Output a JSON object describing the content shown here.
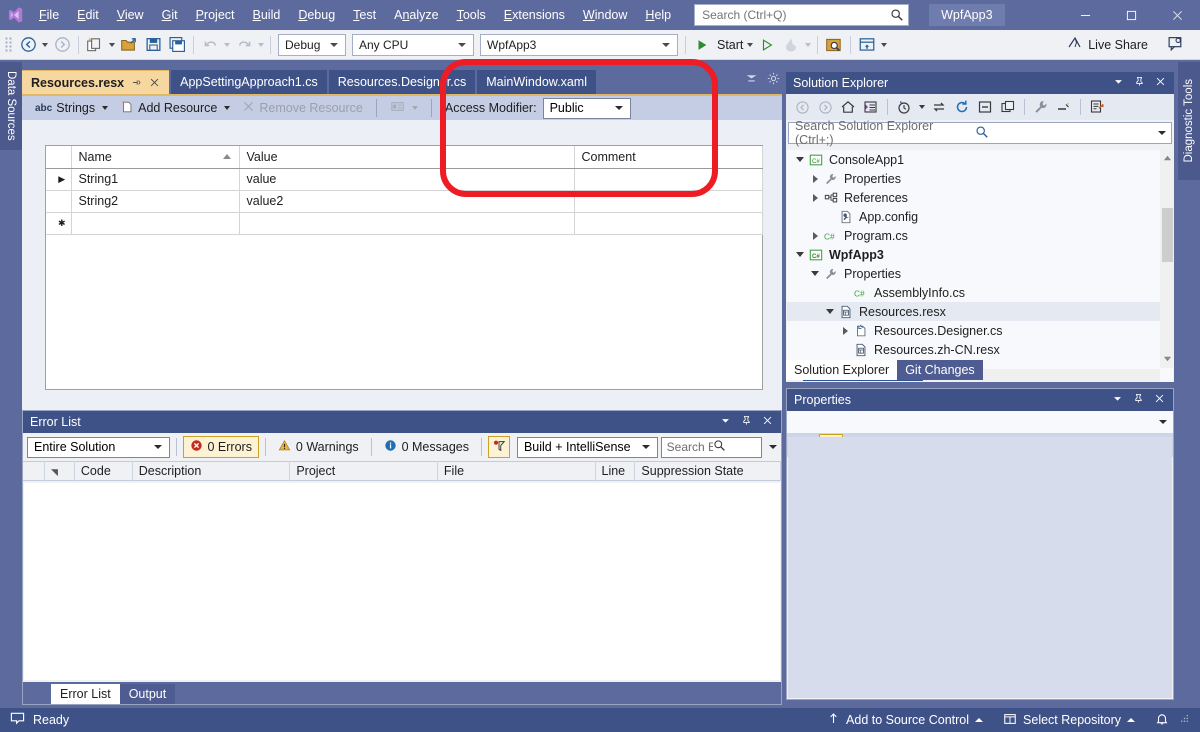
{
  "titlebar": {
    "logo_icon": "visual-studio-logo",
    "menus": [
      "File",
      "Edit",
      "View",
      "Git",
      "Project",
      "Build",
      "Debug",
      "Test",
      "Analyze",
      "Tools",
      "Extensions",
      "Window",
      "Help"
    ],
    "search_placeholder": "Search (Ctrl+Q)",
    "search_icon": "search-icon",
    "project_name": "WpfApp3",
    "minimize_icon": "minimize-icon",
    "maximize_icon": "maximize-icon",
    "close_icon": "close-icon"
  },
  "toolbar": {
    "nav_back_icon": "navigate-back-icon",
    "nav_forward_icon": "navigate-forward-icon",
    "new_project_icon": "new-project-icon",
    "open_file_icon": "open-file-icon",
    "save_icon": "save-icon",
    "save_all_icon": "save-all-icon",
    "undo_icon": "undo-icon",
    "redo_icon": "redo-icon",
    "configuration": "Debug",
    "platform": "Any CPU",
    "startup_project": "WpfApp3",
    "start_label": "Start",
    "start_icon": "play-icon",
    "attach_icon": "attach-play-icon",
    "hotreload_icon": "hot-reload-icon",
    "solution_explorer_search_icon": "find-in-files-icon",
    "layout_icon": "window-layout-icon",
    "live_share_label": "Live Share",
    "live_share_icon": "live-share-icon",
    "feedback_icon": "send-feedback-icon"
  },
  "side_tabs": {
    "left": "Data Sources",
    "right": "Diagnostic Tools"
  },
  "editor": {
    "tabs": [
      {
        "label": "Resources.resx",
        "active": true,
        "pin_icon": "pin-icon",
        "close_icon": "close-icon"
      },
      {
        "label": "AppSettingApproach1.cs",
        "active": false
      },
      {
        "label": "Resources.Designer.cs",
        "active": false
      },
      {
        "label": "MainWindow.xaml",
        "active": false
      }
    ],
    "tab_overflow_icon": "tab-overflow-icon",
    "tab_settings_icon": "gear-icon",
    "toolbar": {
      "strings_icon": "abc-icon",
      "strings_label": "Strings",
      "add_resource_icon": "add-resource-icon",
      "add_resource_label": "Add Resource",
      "remove_resource_icon": "remove-resource-icon",
      "remove_resource_label": "Remove Resource",
      "view_icon": "view-mode-icon",
      "access_modifier_label": "Access Modifier:",
      "access_modifier_value": "Public"
    },
    "grid": {
      "columns": [
        "",
        "Name",
        "Value",
        "Comment"
      ],
      "sorted_column": "Name",
      "sort_direction": "ascending",
      "rows": [
        {
          "marker": "▶",
          "name": "String1",
          "value": "value",
          "comment": ""
        },
        {
          "marker": "",
          "name": "String2",
          "value": "value2",
          "comment": ""
        },
        {
          "marker": "✱",
          "name": "",
          "value": "",
          "comment": ""
        }
      ]
    }
  },
  "error_list": {
    "title": "Error List",
    "dropdown_icon": "panel-menu-icon",
    "pin_icon": "pin-icon",
    "close_icon": "close-icon",
    "scope": "Entire Solution",
    "errors_label": "0 Errors",
    "errors_icon": "error-icon",
    "warnings_label": "0 Warnings",
    "warnings_icon": "warning-icon",
    "messages_label": "0 Messages",
    "messages_icon": "info-icon",
    "filter_icon": "error-filter-icon",
    "build_filter": "Build + IntelliSense",
    "search_placeholder": "Search Error L",
    "search_icon": "search-icon",
    "columns": [
      "",
      "",
      "Code",
      "Description",
      "Project",
      "File",
      "Line",
      "Suppression State"
    ],
    "rows": [],
    "tabs": [
      {
        "label": "Error List",
        "active": true
      },
      {
        "label": "Output",
        "active": false
      }
    ]
  },
  "solution_explorer": {
    "title": "Solution Explorer",
    "dropdown_icon": "panel-menu-icon",
    "pin_icon": "pin-icon",
    "close_icon": "close-icon",
    "toolbar_icons": [
      "back-icon",
      "forward-icon",
      "home-icon",
      "solution-view-icon",
      "pending-changes-icon",
      "sync-with-active-document-icon",
      "refresh-icon",
      "collapse-all-icon",
      "show-all-files-icon",
      "properties-icon",
      "preview-selected-items-icon",
      "edit-project-file-icon"
    ],
    "search_placeholder": "Search Solution Explorer (Ctrl+;)",
    "search_icon": "search-icon",
    "tree": [
      {
        "label": "ConsoleApp1",
        "indent": 0,
        "twist": "open",
        "icon": "csharp-project-icon",
        "bold": false,
        "selected": false
      },
      {
        "label": "Properties",
        "indent": 1,
        "twist": "closed",
        "icon": "properties-wrench-icon",
        "bold": false,
        "selected": false
      },
      {
        "label": "References",
        "indent": 1,
        "twist": "closed",
        "icon": "references-icon",
        "bold": false,
        "selected": false
      },
      {
        "label": "App.config",
        "indent": 2,
        "twist": "none",
        "icon": "config-file-icon",
        "bold": false,
        "selected": false
      },
      {
        "label": "Program.cs",
        "indent": 1,
        "twist": "closed",
        "icon": "csharp-file-icon",
        "bold": false,
        "selected": false
      },
      {
        "label": "WpfApp3",
        "indent": 0,
        "twist": "open",
        "icon": "csharp-project-icon",
        "bold": true,
        "selected": false
      },
      {
        "label": "Properties",
        "indent": 1,
        "twist": "open",
        "icon": "properties-wrench-icon",
        "bold": false,
        "selected": false
      },
      {
        "label": "AssemblyInfo.cs",
        "indent": 3,
        "twist": "none",
        "icon": "csharp-file-icon",
        "bold": false,
        "selected": false
      },
      {
        "label": "Resources.resx",
        "indent": 2,
        "twist": "open",
        "icon": "resx-file-icon",
        "bold": false,
        "selected": true
      },
      {
        "label": "Resources.Designer.cs",
        "indent": 3,
        "twist": "closed",
        "icon": "designer-file-icon",
        "bold": false,
        "selected": false
      },
      {
        "label": "Resources.zh-CN.resx",
        "indent": 3,
        "twist": "none",
        "icon": "resx-file-icon",
        "bold": false,
        "selected": false
      }
    ],
    "bottom_tabs": [
      {
        "label": "Solution Explorer",
        "active": true
      },
      {
        "label": "Git Changes",
        "active": false
      }
    ]
  },
  "properties": {
    "title": "Properties",
    "dropdown_icon": "panel-menu-icon",
    "pin_icon": "pin-icon",
    "close_icon": "close-icon",
    "object_selector_icon": "chevron-down-icon",
    "categorized_icon": "categorized-view-icon",
    "alphabetical_icon": "alphabetical-sort-icon",
    "property_pages_icon": "property-pages-icon"
  },
  "statusbar": {
    "ready_icon": "ready-icon",
    "ready_text": "Ready",
    "add_to_source_control": "Add to Source Control",
    "add_to_source_control_icon": "upload-arrow-icon",
    "select_repository": "Select Repository",
    "select_repository_icon": "repository-icon",
    "notifications_icon": "bell-icon"
  },
  "annotation": {
    "shape": "rounded-rectangle",
    "color": "#ee1c25"
  },
  "colors": {
    "title_bar": "#5c6a9e",
    "accent_tab": "#f6d7a0",
    "panel_header": "#3f5288",
    "command_bar": "#eff1f5",
    "annotation_red": "#ee1c25"
  }
}
